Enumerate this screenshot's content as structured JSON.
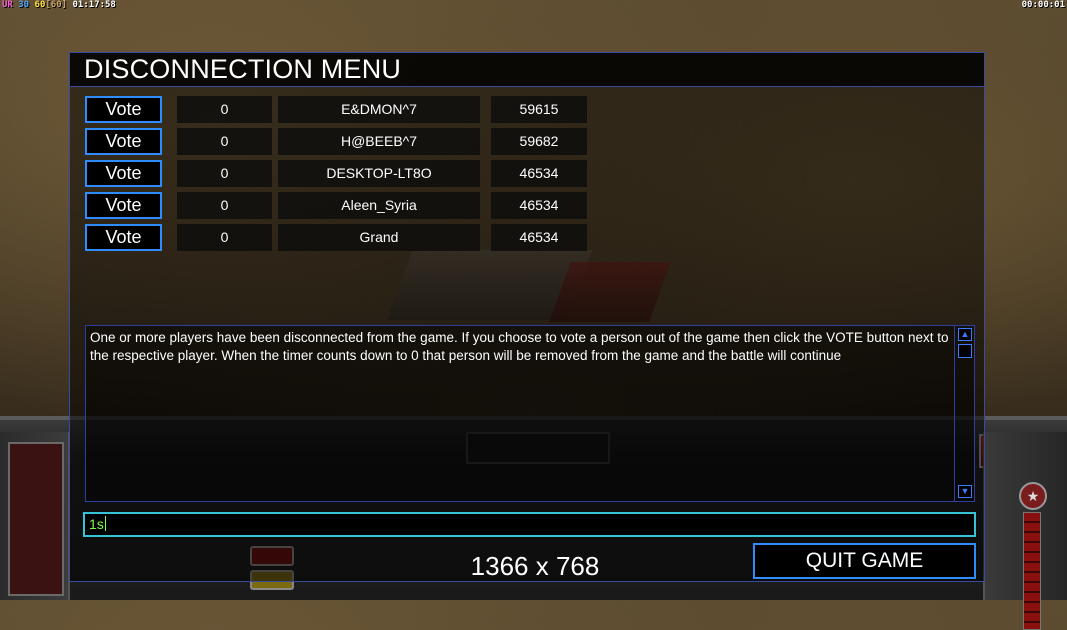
{
  "overlay": {
    "stats_ur": "UR",
    "stats_fps_a": "30",
    "stats_fps_b": "60",
    "stats_bracket_open": "[",
    "stats_fps_cap": "60",
    "stats_bracket_close": "]",
    "stats_time": "01:17:58",
    "clock_right": "00:00:01"
  },
  "dialog": {
    "title": "DISCONNECTION MENU",
    "vote_label": "Vote",
    "players": [
      {
        "vote_label": "Vote",
        "votes": "0",
        "name": "E&DMON^7",
        "ping": "59615"
      },
      {
        "vote_label": "Vote",
        "votes": "0",
        "name": "H@BEEB^7",
        "ping": "59682"
      },
      {
        "vote_label": "Vote",
        "votes": "0",
        "name": "DESKTOP-LT8O",
        "ping": "46534"
      },
      {
        "vote_label": "Vote",
        "votes": "0",
        "name": "Aleen_Syria",
        "ping": "46534"
      },
      {
        "vote_label": "Vote",
        "votes": "0",
        "name": "Grand",
        "ping": "46534"
      }
    ],
    "message": "One or more players have been disconnected from the game. If you choose to vote a person out of the game then click the VOTE button next to the respective player. When the timer counts down to 0 that person will be removed from the game and the battle will continue",
    "chat_value": "1s",
    "resolution_label": "1366 x 768",
    "quit_label": "QUIT GAME"
  },
  "colors": {
    "accent_blue": "#2f8cff",
    "chat_border": "#36c3d8",
    "chat_text": "#7cff4a"
  },
  "icons": {
    "scroll_up": "triangle-up-icon",
    "scroll_down": "triangle-down-icon"
  }
}
